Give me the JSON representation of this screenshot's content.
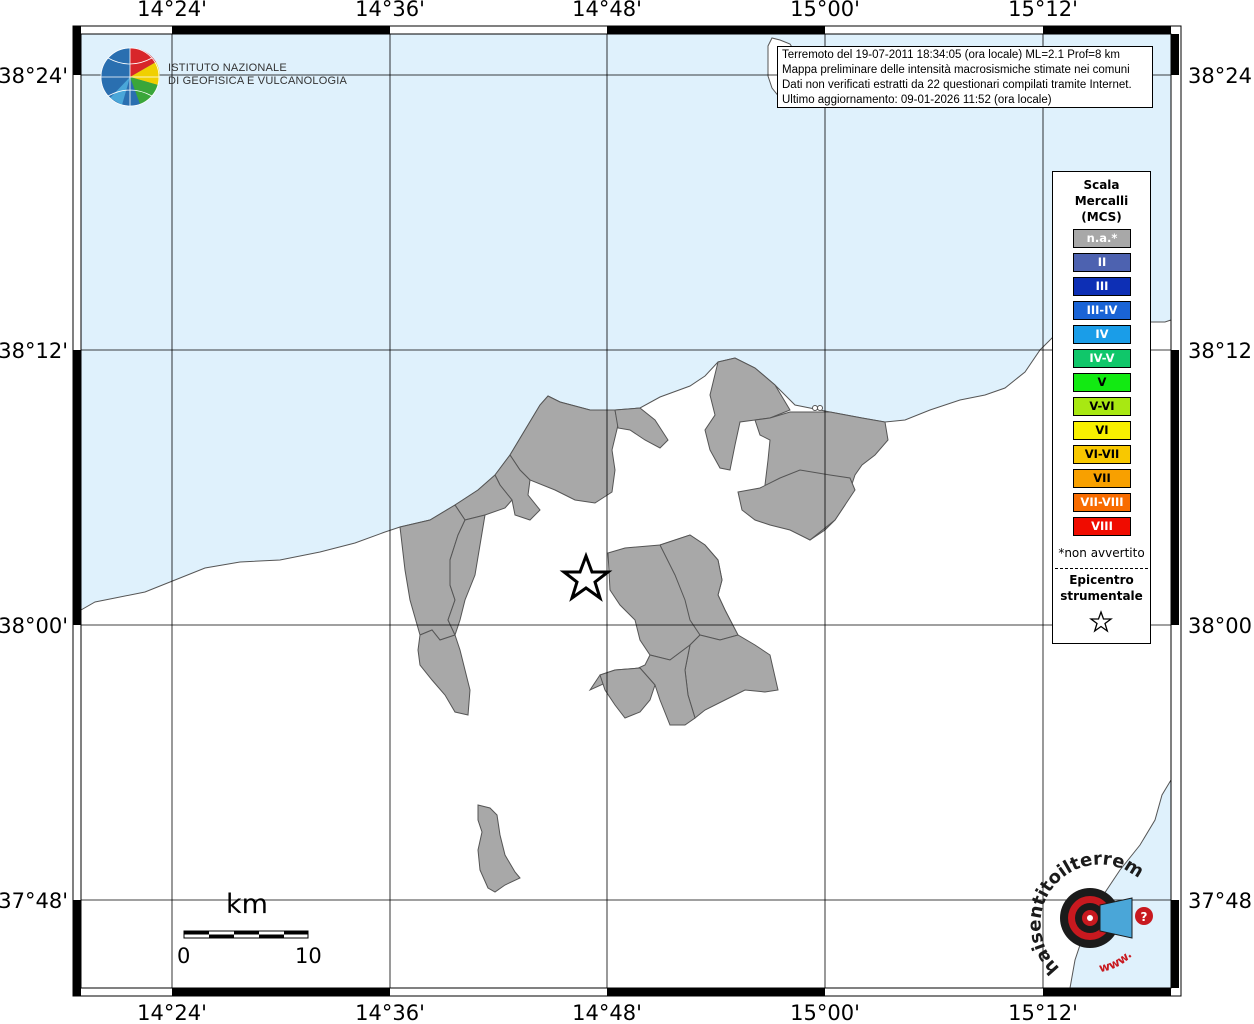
{
  "map": {
    "longitude_labels": [
      "14°24'",
      "14°36'",
      "14°48'",
      "15°00'",
      "15°12'"
    ],
    "latitude_labels": [
      "38°24'",
      "38°12'",
      "38°00'",
      "37°48'"
    ],
    "colors": {
      "sea": "#dff1fc",
      "land": "#ffffff",
      "municipality": "#a8a8a8",
      "grid": "#000000"
    }
  },
  "info_box": {
    "line1": "Terremoto del 19-07-2011 18:34:05 (ora locale) ML=2.1 Prof=8 km",
    "line2": "Mappa preliminare delle intensità macrosismiche stimate nei comuni",
    "line3": "Dati non verificati estratti da 22 questionari compilati tramite Internet.",
    "line4": "Ultimo aggiornamento: 09-01-2026 11:52 (ora locale)"
  },
  "logo_ingv": {
    "line1": "ISTITUTO NAZIONALE",
    "line2": "DI GEOFISICA E VULCANOLOGIA"
  },
  "legend": {
    "title": [
      "Scala",
      "Mercalli",
      "(MCS)"
    ],
    "items": [
      {
        "label": "n.a.*",
        "color": "#a8a8a8"
      },
      {
        "label": "II",
        "color": "#4d62b0"
      },
      {
        "label": "III",
        "color": "#0d2fb5"
      },
      {
        "label": "III-IV",
        "color": "#1a64d6"
      },
      {
        "label": "IV",
        "color": "#1a9de8"
      },
      {
        "label": "IV-V",
        "color": "#10c76a"
      },
      {
        "label": "V",
        "color": "#12ea12"
      },
      {
        "label": "V-VI",
        "color": "#a8e812"
      },
      {
        "label": "VI",
        "color": "#f8f000"
      },
      {
        "label": "VI-VII",
        "color": "#f8c800"
      },
      {
        "label": "VII",
        "color": "#f8a000"
      },
      {
        "label": "VII-VIII",
        "color": "#f86c00"
      },
      {
        "label": "VIII",
        "color": "#f00c00"
      }
    ],
    "note": "*non avvertito",
    "epicenter_label": [
      "Epicentro",
      "strumentale"
    ]
  },
  "scale_bar": {
    "unit": "km",
    "start": "0",
    "end": "10"
  },
  "logo_hsst": {
    "text": "haisentitoilterremoto.it",
    "url": "www.",
    "icon": "speaker-icon"
  }
}
